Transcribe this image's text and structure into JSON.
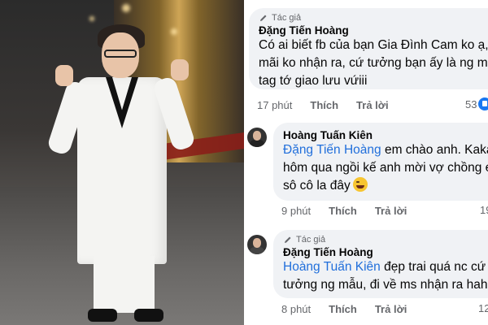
{
  "photo": {
    "alt": "Man in white suit posing at event"
  },
  "comments": [
    {
      "author_tag": "Tác giả",
      "author": "Đặng Tiến Hoàng",
      "lines": [
        "Có ai biết fb của bạn Gia Đình Cam ko ạ,",
        "mãi ko nhận ra, cứ tưởng bạn ấy là ng m",
        "tag tớ giao lưu vứiii"
      ],
      "time": "17 phút",
      "like": "Thích",
      "reply": "Trả lời",
      "reactions": "53"
    },
    {
      "author": "Hoàng Tuấn Kiên",
      "mention": "Đặng Tiến Hoàng",
      "lines_first_rest": " em chào anh. Kaka",
      "lines": [
        "hôm qua ngồi kế anh mời vợ chồng e",
        "sô cô la đây"
      ],
      "time": "9 phút",
      "like": "Thích",
      "reply": "Trả lời",
      "reactions": "19"
    },
    {
      "author_tag": "Tác giả",
      "author": "Đặng Tiến Hoàng",
      "mention": "Hoàng Tuấn Kiên",
      "lines_first_rest": " đẹp trai quá nc cứ",
      "lines": [
        "tưởng ng mẫu, đi về ms nhận ra hah"
      ],
      "time": "8 phút",
      "like": "Thích",
      "reply": "Trả lời",
      "reactions": "12"
    }
  ],
  "colors": {
    "mention": "#216fdb",
    "bubble": "#f0f2f5",
    "meta": "#65676b"
  },
  "icons": {
    "author_badge": "pen-icon",
    "reaction": "like-icon",
    "emoji": "laughing-emoji-icon"
  }
}
